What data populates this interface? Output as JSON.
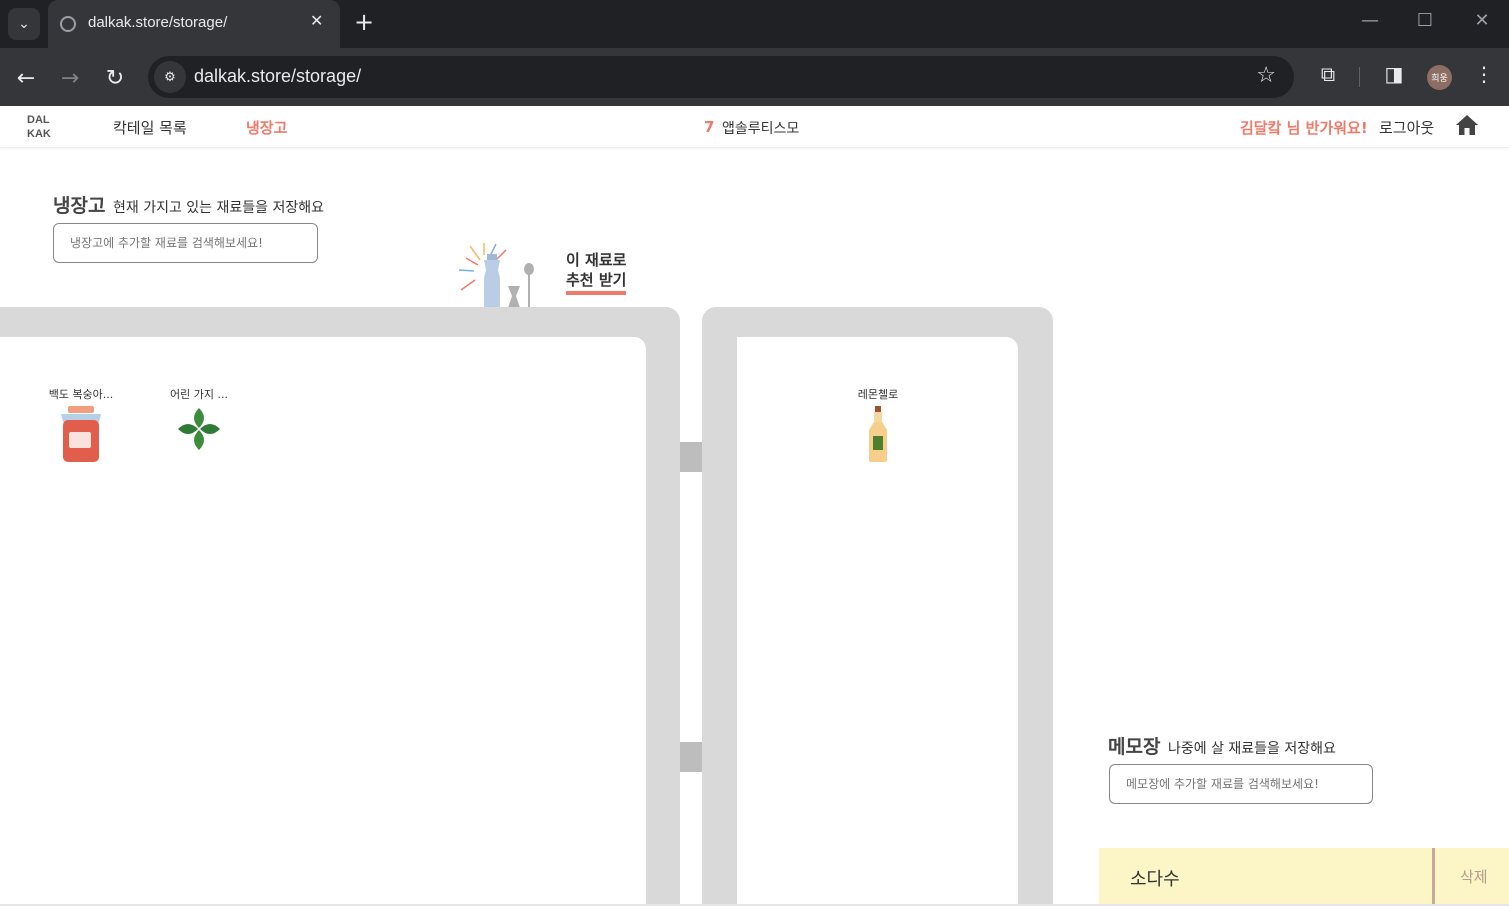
{
  "browser": {
    "tab_title": "dalkak.store/storage/",
    "url": "dalkak.store/storage/",
    "profile_label": "희웅"
  },
  "header": {
    "logo_line1": "DAL",
    "logo_line2": "KAK",
    "nav_cocktails": "칵테일 목록",
    "nav_fridge": "냉장고",
    "rank_number": "7",
    "rank_name": "앱솔루티스모",
    "welcome": "김달캌 님 반가워요!",
    "logout": "로그아웃"
  },
  "fridge": {
    "title": "냉장고",
    "subtitle": "현재 가지고 있는 재료들을 저장해요",
    "search_placeholder": "냉장고에 추가할 재료를 검색해보세요!",
    "recommend_line1": "이 재료로",
    "recommend_line2": "추천 받기",
    "left_items": [
      {
        "label": "백도 복숭아...",
        "icon": "jam-jar-icon"
      },
      {
        "label": "어린 가지 ...",
        "icon": "basil-leaf-icon"
      }
    ],
    "right_items": [
      {
        "label": "레몬첼로",
        "icon": "bottle-icon"
      }
    ]
  },
  "memo": {
    "title": "메모장",
    "subtitle": "나중에 살 재료들을 저장해요",
    "search_placeholder": "메모장에 추가할 재료를 검색해보세요!",
    "items": [
      {
        "label": "소다수",
        "delete_label": "삭제"
      }
    ]
  },
  "colors": {
    "accent": "#f07a6a",
    "fridge_frame": "#d9d9d9",
    "memo_bg": "#fcf6c6"
  }
}
